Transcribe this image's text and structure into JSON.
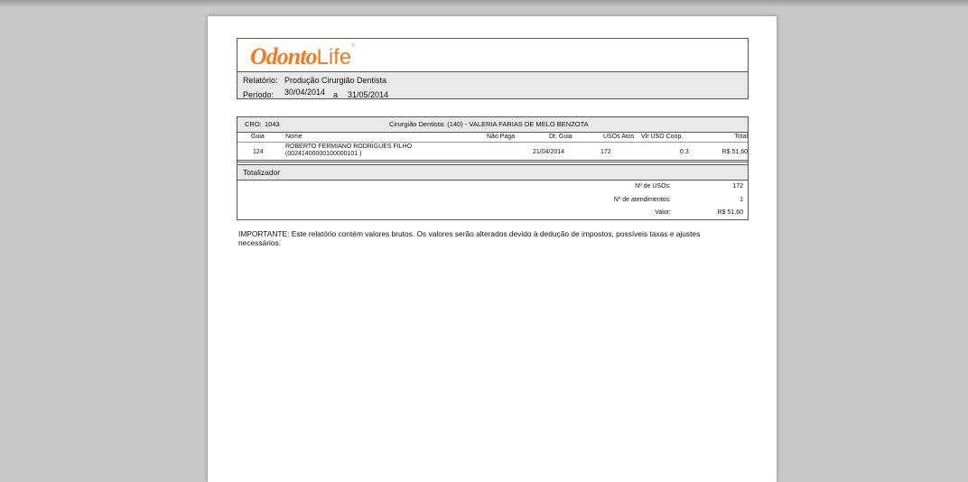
{
  "header": {
    "logo_text": "OdontoLife",
    "logo_part1": "Odonto",
    "logo_part2": "Life",
    "logo_mark": "®",
    "relatorio_label": "Relatório:",
    "relatorio_value": "Produção Cirurgião Dentista",
    "periodo_label": "Período:",
    "periodo_start": "30/04/2014",
    "periodo_sep": "a",
    "periodo_end": "31/05/2014"
  },
  "details": {
    "cro_label": "CRO:",
    "cro_value": "1043",
    "dentist": "Cirurgião Dentista: (140) - VALERIA FARIAS DE MELO BENZOTA",
    "columns": [
      "Guia",
      "Nome",
      "Não Paga",
      "Dt. Guia",
      "USOs Atos",
      "Vlr USO Coop.",
      "Total"
    ],
    "rows": [
      {
        "guia": "124",
        "nome_line1": "ROBERTO FERMIANO RODRIGUES FILHO",
        "nome_line2": "(00241400000100000101 )",
        "nao_paga": "",
        "dt_guia": "21/04/2014",
        "usos_atos": "172",
        "vlr_uso": "0.3",
        "total": "R$ 51,60"
      }
    ]
  },
  "totalizador": {
    "title": "Totalizador",
    "usos_label": "Nº de USOs:",
    "usos_value": "172",
    "atend_label": "Nº de atendimentos:",
    "atend_value": "1",
    "valor_label": "Valor:",
    "valor_value": "R$ 51,60"
  },
  "note": {
    "line1": "IMPORTANTE: Este relatório contém valores brutos. Os valores serão alterados devido à dedução de impostos, possíveis taxas e ajustes",
    "line2": "necessários."
  },
  "colors": {
    "brand": "#ef7b22",
    "header_bg": "#e9e9e9",
    "border": "#555555"
  }
}
